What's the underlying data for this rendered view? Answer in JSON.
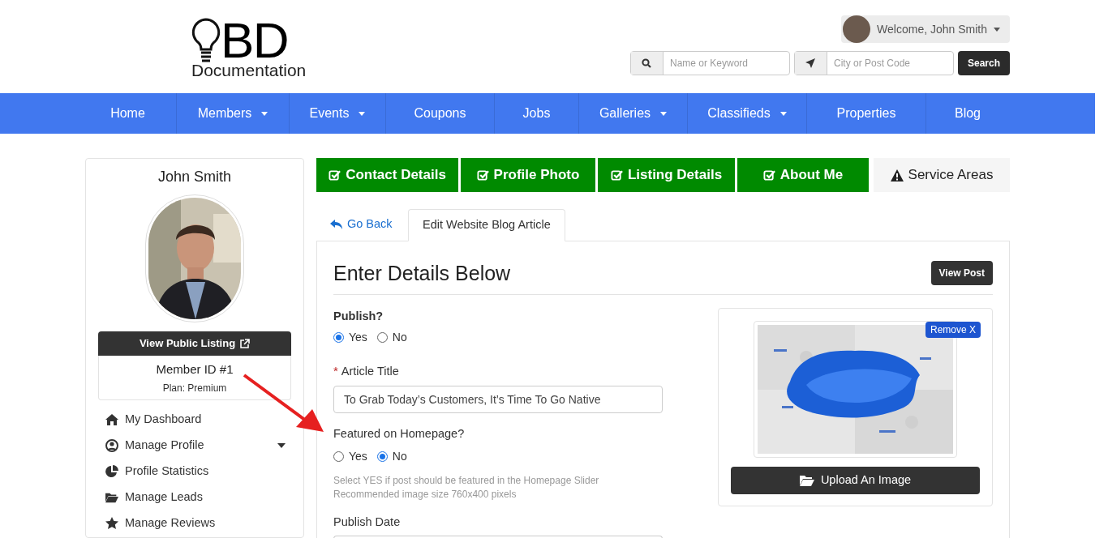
{
  "header": {
    "logo": {
      "mark": "BD",
      "caption": "Documentation"
    },
    "user_menu": {
      "label": "Welcome, John Smith"
    },
    "search": {
      "keyword_placeholder": "Name or Keyword",
      "location_placeholder": "City or Post Code",
      "button": "Search"
    }
  },
  "nav": {
    "items": [
      {
        "label": "Home",
        "dropdown": false
      },
      {
        "label": "Members",
        "dropdown": true
      },
      {
        "label": "Events",
        "dropdown": true
      },
      {
        "label": "Coupons",
        "dropdown": false
      },
      {
        "label": "Jobs",
        "dropdown": false
      },
      {
        "label": "Galleries",
        "dropdown": true
      },
      {
        "label": "Classifieds",
        "dropdown": true
      },
      {
        "label": "Properties",
        "dropdown": false
      },
      {
        "label": "Blog",
        "dropdown": false
      }
    ]
  },
  "sidebar": {
    "name": "John Smith",
    "view_listing_button": "View Public Listing",
    "member_id": "Member ID #1",
    "plan": "Plan: Premium",
    "menu": [
      {
        "label": "My Dashboard",
        "expandable": false
      },
      {
        "label": "Manage Profile",
        "expandable": true
      },
      {
        "label": "Profile Statistics",
        "expandable": false
      },
      {
        "label": "Manage Leads",
        "expandable": false
      },
      {
        "label": "Manage Reviews",
        "expandable": false
      }
    ]
  },
  "steps": [
    {
      "label": "Contact Details",
      "complete": true
    },
    {
      "label": "Profile Photo",
      "complete": true
    },
    {
      "label": "Listing Details",
      "complete": true
    },
    {
      "label": "About Me",
      "complete": true
    },
    {
      "label": "Service Areas",
      "complete": false
    }
  ],
  "tabs": [
    {
      "label": "Go Back",
      "kind": "link",
      "selected": false
    },
    {
      "label": "Edit Website Blog Article",
      "kind": "tab",
      "selected": true
    }
  ],
  "form": {
    "heading": "Enter Details Below",
    "view_button": "View Post",
    "publish": {
      "label": "Publish?",
      "options": [
        {
          "label": "Yes",
          "selected": true
        },
        {
          "label": "No",
          "selected": false
        }
      ]
    },
    "article_title": {
      "label": "Article Title",
      "required_mark": "*",
      "value": "To Grab Today’s Customers, It’s Time To Go Native"
    },
    "featured": {
      "label": "Featured on Homepage?",
      "options": [
        {
          "label": "Yes",
          "selected": false
        },
        {
          "label": "No",
          "selected": true
        }
      ],
      "help": [
        "Select YES if post should be featured in the Homepage Slider",
        "Recommended image size 760x400 pixels"
      ]
    },
    "publish_date": {
      "label": "Publish Date"
    }
  },
  "image_card": {
    "remove_button": "Remove X",
    "upload_button": "Upload An Image"
  }
}
